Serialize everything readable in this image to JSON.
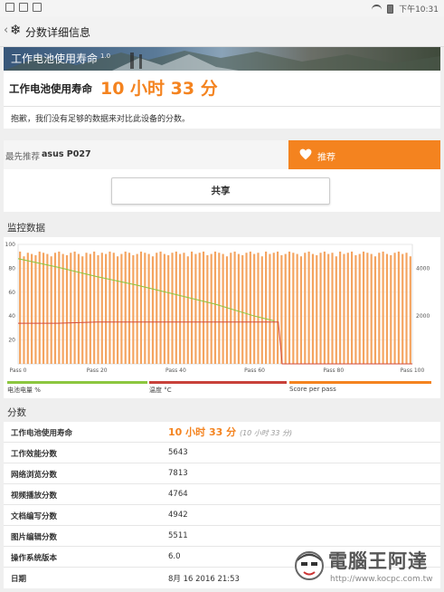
{
  "statusbar": {
    "time": "下午10:31"
  },
  "appbar": {
    "title": "分数详细信息"
  },
  "banner": {
    "title": "工作电池使用寿命",
    "version": "1.0"
  },
  "result": {
    "label": "工作电池使用寿命",
    "value": "10 小时 33 分"
  },
  "note": "抱歉，我们没有足够的数据来对比此设备的分数。",
  "recommend": {
    "label": "最先推荐",
    "device": "asus P027",
    "button": "推荐"
  },
  "share_label": "共享",
  "monitor_title": "监控数据",
  "chart_data": {
    "type": "bar",
    "x_tick_labels": [
      "Pass 0",
      "Pass 20",
      "Pass 40",
      "Pass 60",
      "Pass 80",
      "Pass 100"
    ],
    "xlim": [
      0,
      100
    ],
    "y_left_ticks": [
      "20",
      "40",
      "60",
      "80",
      "100"
    ],
    "ylim_left": [
      0,
      100
    ],
    "y_right_ticks": [
      "2000",
      "4000"
    ],
    "ylim_right": [
      0,
      5000
    ],
    "series": [
      {
        "name": "电池电量 %",
        "type": "line",
        "color": "#8cc63f",
        "x": [
          0,
          10,
          20,
          30,
          40,
          50,
          60,
          65,
          70,
          80,
          90,
          100
        ],
        "y": [
          88,
          81,
          73,
          66,
          58,
          50,
          40,
          36,
          null,
          null,
          null,
          null
        ]
      },
      {
        "name": "温度 °C",
        "type": "line",
        "color": "#d24b3c",
        "x": [
          0,
          10,
          20,
          30,
          40,
          50,
          60,
          66,
          67,
          80,
          90,
          100
        ],
        "y": [
          34,
          34,
          35,
          35,
          35,
          35,
          35,
          35,
          0,
          0,
          0,
          0
        ]
      },
      {
        "name": "Score per pass",
        "type": "bar",
        "color": "#f4a460",
        "values": [
          4700,
          4500,
          4650,
          4600,
          4550,
          4700,
          4650,
          4600,
          4500,
          4650,
          4700,
          4600,
          4550,
          4650,
          4700,
          4600,
          4500,
          4650,
          4600,
          4700,
          4550,
          4650,
          4600,
          4700,
          4650,
          4500,
          4600,
          4700,
          4650,
          4550,
          4600,
          4700,
          4650,
          4600,
          4500,
          4650,
          4700,
          4600,
          4550,
          4650,
          4700,
          4600,
          4650,
          4500,
          4700,
          4600,
          4650,
          4700,
          4550,
          4600,
          4700,
          4650,
          4600,
          4500,
          4650,
          4700,
          4600,
          4550,
          4650,
          4700,
          4600,
          4650,
          4500,
          4700,
          4600,
          4650,
          4700,
          4550,
          4600,
          4700,
          4650,
          4600,
          4500,
          4650,
          4700,
          4600,
          4550,
          4650,
          4700,
          4600,
          4650,
          4500,
          4700,
          4600,
          4650,
          4700,
          4550,
          4600,
          4700,
          4650,
          4600,
          4500,
          4650,
          4700,
          4600,
          4550,
          4650,
          4700,
          4600,
          4650,
          4500
        ]
      }
    ]
  },
  "legend": [
    {
      "label": "电池电量 %",
      "color": "#8cc63f"
    },
    {
      "label": "温度 °C",
      "color": "#c8413a"
    },
    {
      "label": "Score per pass",
      "color": "#f4831f"
    }
  ],
  "scores_title": "分数",
  "scores": [
    {
      "key": "工作电池使用寿命",
      "value": "10 小时 33 分",
      "sub": "(10 小时 33 分)"
    },
    {
      "key": "工作效能分数",
      "value": "5643"
    },
    {
      "key": "网络浏览分数",
      "value": "7813"
    },
    {
      "key": "视频播放分数",
      "value": "4764"
    },
    {
      "key": "文档编写分数",
      "value": "4942"
    },
    {
      "key": "图片编辑分数",
      "value": "5511"
    },
    {
      "key": "操作系统版本",
      "value": "6.0"
    },
    {
      "key": "日期",
      "value": "8月 16 2016 21:53"
    }
  ],
  "watermark": {
    "title": "電腦王阿達",
    "url": "http://www.kocpc.com.tw"
  }
}
